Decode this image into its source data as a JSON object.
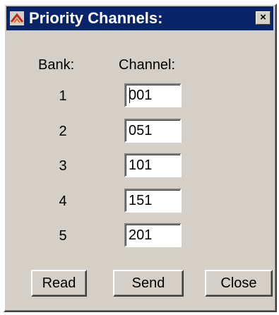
{
  "window": {
    "title": "Priority Channels:",
    "close_glyph": "×",
    "title_bar_color": "#0a246a",
    "icon": "app-icon"
  },
  "headers": {
    "bank": "Bank:",
    "channel": "Channel:"
  },
  "rows": [
    {
      "bank": "1",
      "channel": "001"
    },
    {
      "bank": "2",
      "channel": "051"
    },
    {
      "bank": "3",
      "channel": "101"
    },
    {
      "bank": "4",
      "channel": "151"
    },
    {
      "bank": "5",
      "channel": "201"
    }
  ],
  "buttons": {
    "read": "Read",
    "send": "Send",
    "close": "Close"
  }
}
